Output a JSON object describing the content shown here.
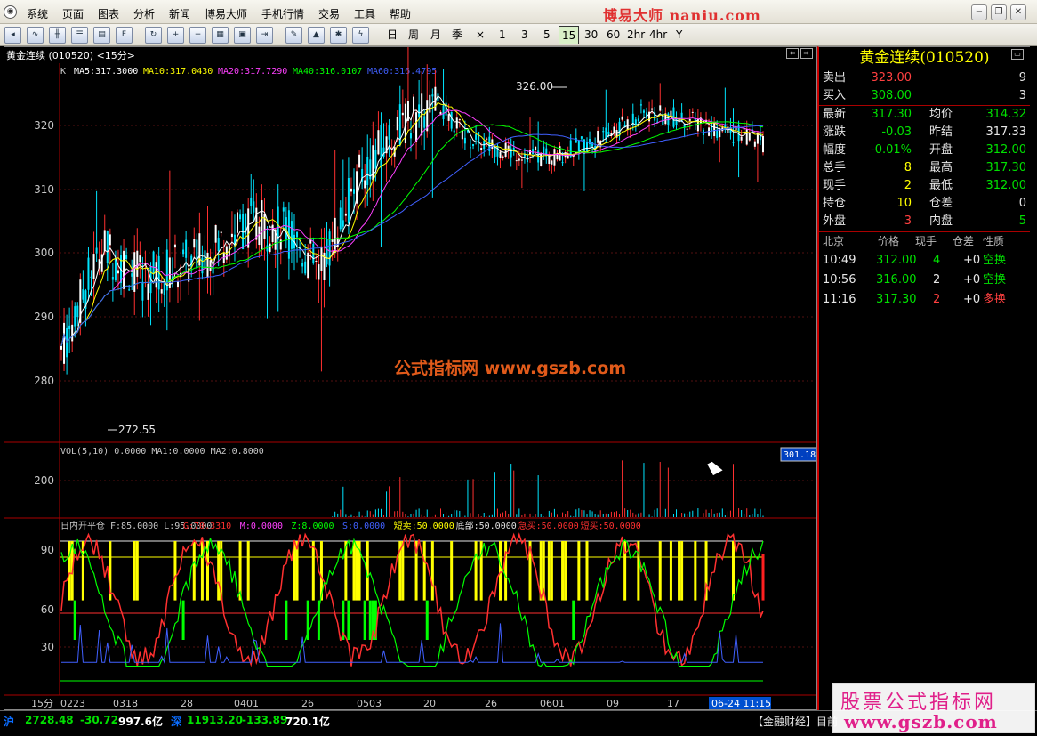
{
  "app": {
    "brand": "博易大师 naniu.com"
  },
  "menu": [
    "系统",
    "页面",
    "图表",
    "分析",
    "新闻",
    "博易大师",
    "手机行情",
    "交易",
    "工具",
    "帮助"
  ],
  "periods": [
    "日",
    "周",
    "月",
    "季",
    "×",
    "1",
    "3",
    "5",
    "15",
    "30",
    "60",
    "2hr",
    "4hr",
    "Y"
  ],
  "active_period": "15",
  "chart": {
    "header": "黄金连续 (010520) <15分>",
    "ma_legend": [
      {
        "text": "MA5:317.3000",
        "color": "#ffffff"
      },
      {
        "text": "MA10:317.0430",
        "color": "#ffff00"
      },
      {
        "text": "MA20:317.7290",
        "color": "#ff40ff"
      },
      {
        "text": "MA40:316.0107",
        "color": "#00ff00"
      },
      {
        "text": "MA60:316.4795",
        "color": "#4060ff"
      }
    ],
    "k_label": "K",
    "high_mark": "326.00",
    "low_mark": "272.55",
    "watermark": "公式指标网  www.gszb.com",
    "price_ticks": [
      "320",
      "310",
      "300",
      "290",
      "280"
    ],
    "vol_legend": "VOL(5,10) 0.0000  MA1:0.0000  MA2:0.8000",
    "vol_tick": "200",
    "vol_value_box": "301.18",
    "ind_legend": [
      {
        "text": "日内开平仓 F:85.0000  L:95.0000",
        "color": "#c8c8c8"
      },
      {
        "text": "G:70.3310",
        "color": "#ff3030"
      },
      {
        "text": "M:0.0000",
        "color": "#ff40ff"
      },
      {
        "text": "Z:8.0000",
        "color": "#00ff00"
      },
      {
        "text": "S:0.0000",
        "color": "#4060ff"
      },
      {
        "text": "短卖:50.0000",
        "color": "#ffff00"
      },
      {
        "text": "底部:50.0000",
        "color": "#e0e0e0"
      },
      {
        "text": "急买:50.0000",
        "color": "#ff3030"
      },
      {
        "text": "短买:50.0000",
        "color": "#ff3030"
      }
    ],
    "ind_ticks": [
      "90",
      "60",
      "30"
    ],
    "x_period_label": "15分",
    "x_labels": [
      "0223",
      "0318",
      "28",
      "0401",
      "26",
      "0503",
      "20",
      "26",
      "0601",
      "09",
      "17"
    ],
    "x_cursor": "06-24 11:15"
  },
  "quote": {
    "title": "黄金连续(010520)",
    "sell": {
      "label": "卖出",
      "price": "323.00",
      "vol": "9"
    },
    "buy": {
      "label": "买入",
      "price": "308.00",
      "vol": "3"
    },
    "rows": [
      {
        "l1": "最新",
        "v1": "317.30",
        "c1": "green",
        "l2": "均价",
        "v2": "314.32",
        "c2": "green"
      },
      {
        "l1": "涨跌",
        "v1": "-0.03",
        "c1": "green",
        "l2": "昨结",
        "v2": "317.33",
        "c2": "white"
      },
      {
        "l1": "幅度",
        "v1": "-0.01%",
        "c1": "green",
        "l2": "开盘",
        "v2": "312.00",
        "c2": "green"
      },
      {
        "l1": "总手",
        "v1": "8",
        "c1": "yellow",
        "l2": "最高",
        "v2": "317.30",
        "c2": "green"
      },
      {
        "l1": "现手",
        "v1": "2",
        "c1": "yellow",
        "l2": "最低",
        "v2": "312.00",
        "c2": "green"
      },
      {
        "l1": "持仓",
        "v1": "10",
        "c1": "yellow",
        "l2": "仓差",
        "v2": "0",
        "c2": "white"
      },
      {
        "l1": "外盘",
        "v1": "3",
        "c1": "red",
        "l2": "内盘",
        "v2": "5",
        "c2": "green"
      }
    ],
    "tick_headers": [
      "北京",
      "价格",
      "现手",
      "仓差",
      "性质"
    ],
    "ticks": [
      {
        "time": "10:49",
        "price": "312.00",
        "vol": "4",
        "vol_color": "green",
        "diff": "+0",
        "nature": "空换",
        "nature_color": "green"
      },
      {
        "time": "10:56",
        "price": "316.00",
        "vol": "2",
        "vol_color": "white",
        "diff": "+0",
        "nature": "空换",
        "nature_color": "green"
      },
      {
        "time": "11:16",
        "price": "317.30",
        "vol": "2",
        "vol_color": "red",
        "diff": "+0",
        "nature": "多换",
        "nature_color": "red"
      }
    ]
  },
  "status": {
    "sh_label": "沪",
    "sh_index": "2728.48",
    "sh_change": "-30.72",
    "sh_amount": "997.6亿",
    "sz_label": "深",
    "sz_index": "11913.20",
    "sz_change": "-133.89",
    "sz_amount": "720.1亿",
    "news": "【金融财经】目前"
  },
  "watermark2": {
    "line1": "股票公式指标网",
    "line2": "www.gszb.com"
  },
  "colors": {
    "up": "#ff3030",
    "down": "#00ff00",
    "frame": "#aa0000"
  }
}
